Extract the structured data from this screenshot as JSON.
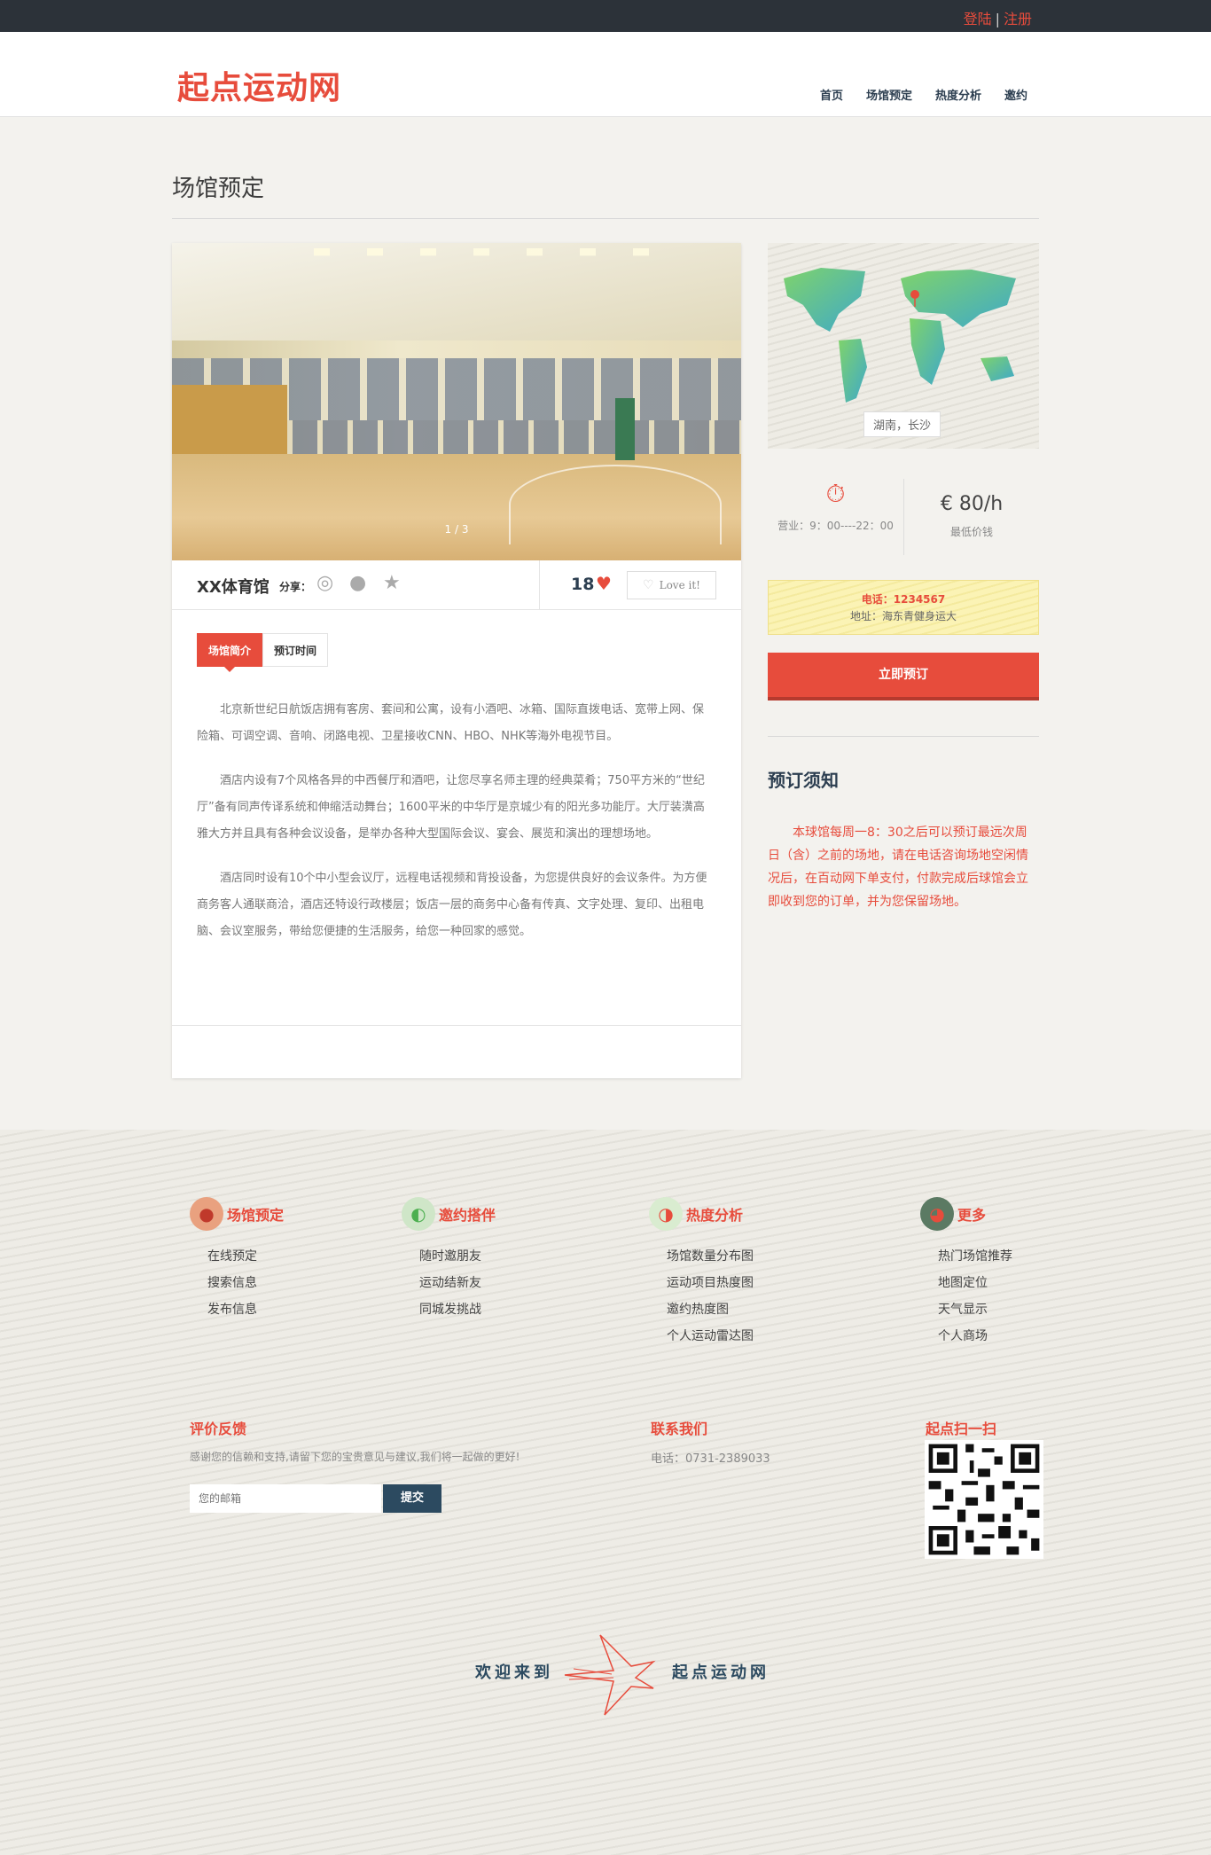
{
  "topbar": {
    "login": "登陆",
    "separator": "|",
    "register": "注册"
  },
  "header": {
    "logo": "起点运动网",
    "nav": [
      "首页",
      "场馆预定",
      "热度分析",
      "邀约"
    ]
  },
  "page": {
    "title": "场馆预定"
  },
  "venue": {
    "slide_counter": "1 / 3",
    "name": "XX体育馆",
    "share_label": "分享：",
    "like_count": "18",
    "love_button": "Love it!",
    "tabs": [
      "场馆简介",
      "预订时间"
    ],
    "description": [
      "北京新世纪日航饭店拥有客房、套间和公寓，设有小酒吧、冰箱、国际直拨电话、宽带上网、保险箱、可调空调、音响、闭路电视、卫星接收CNN、HBO、NHK等海外电视节目。",
      "酒店内设有7个风格各异的中西餐厅和酒吧，让您尽享名师主理的经典菜肴；750平方米的“世纪厅”备有同声传译系统和伸缩活动舞台；1600平米的中华厅是京城少有的阳光多功能厅。大厅装潢高雅大方并且具有各种会议设备，是举办各种大型国际会议、宴会、展览和演出的理想场地。",
      "酒店同时设有10个中小型会议厅，远程电话视频和背投设备，为您提供良好的会议条件。为方便商务客人通联商洽，酒店还特设行政楼层；饭店一层的商务中心备有传真、文字处理、复印、出租电脑、会议室服务，带给您便捷的生活服务，给您一种回家的感觉。"
    ]
  },
  "sidebar": {
    "location": "湖南，长沙",
    "hours": "营业：9：00----22：00",
    "price_value": "€ 80/h",
    "price_label": "最低价钱",
    "phone": "电话：1234567",
    "address": "地址：海东青健身运大",
    "book_button": "立即预订",
    "notice_title": "预订须知",
    "notice_text": "本球馆每周一8：30之后可以预订最远次周日（含）之前的场地，请在电话咨询场地空闲情况后，在百动网下单支付，付款完成后球馆会立即收到您的订单，并为您保留场地。"
  },
  "footer": {
    "columns": [
      {
        "title": "场馆预定",
        "icon": "basketball-icon",
        "items": [
          "在线预定",
          "搜索信息",
          "发布信息"
        ]
      },
      {
        "title": "邀约搭伴",
        "icon": "tennis-icon",
        "items": [
          "随时邀朋友",
          "运动结新友",
          "同城发挑战"
        ]
      },
      {
        "title": "热度分析",
        "icon": "chart-icon",
        "items": [
          "场馆数量分布图",
          "运动项目热度图",
          "邀约热度图",
          "个人运动雷达图"
        ]
      },
      {
        "title": "更多",
        "icon": "globe-icon",
        "items": [
          "热门场馆推荐",
          "地图定位",
          "天气显示",
          "个人商场"
        ]
      }
    ],
    "feedback_title": "评价反馈",
    "feedback_sub": "感谢您的信赖和支持,请留下您的宝贵意见与建议,我们将一起做的更好!",
    "email_placeholder": "您的邮箱",
    "submit": "提交",
    "contact_title": "联系我们",
    "contact_phone": "电话：0731-2389033",
    "qr_title": "起点扫一扫",
    "welcome": "欢迎来到",
    "brand": "起点运动网"
  },
  "colors": {
    "accent": "#e74c3c",
    "dark": "#2c3239",
    "navy": "#2c4a60"
  }
}
